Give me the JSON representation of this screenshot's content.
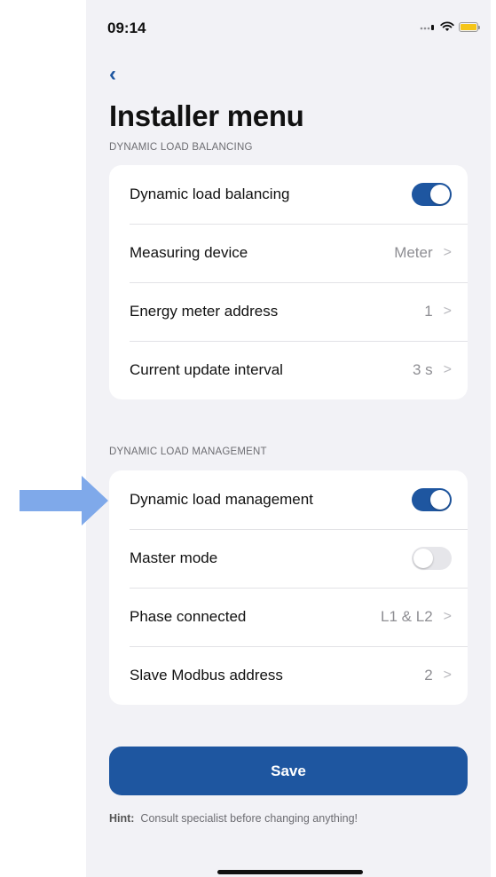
{
  "status_bar": {
    "time": "09:14"
  },
  "nav": {
    "back_glyph": "‹"
  },
  "page": {
    "title": "Installer menu"
  },
  "sections": [
    {
      "header": "DYNAMIC LOAD BALANCING",
      "rows": [
        {
          "label": "Dynamic load balancing",
          "type": "toggle",
          "on": true
        },
        {
          "label": "Measuring device",
          "type": "value",
          "value": "Meter"
        },
        {
          "label": "Energy meter address",
          "type": "value",
          "value": "1"
        },
        {
          "label": "Current update interval",
          "type": "value",
          "value": "3 s"
        }
      ]
    },
    {
      "header": "DYNAMIC LOAD MANAGEMENT",
      "rows": [
        {
          "label": "Dynamic load management",
          "type": "toggle",
          "on": true
        },
        {
          "label": "Master mode",
          "type": "toggle",
          "on": false
        },
        {
          "label": "Phase connected",
          "type": "value",
          "value": "L1 & L2"
        },
        {
          "label": "Slave Modbus address",
          "type": "value",
          "value": "2"
        }
      ]
    }
  ],
  "save_label": "Save",
  "hint": {
    "label": "Hint:",
    "text": "Consult specialist before changing anything!"
  },
  "colors": {
    "accent": "#1e56a0",
    "arrow": "#7fa9ea",
    "background": "#f2f2f6"
  },
  "icons": [
    "signal-icon",
    "wifi-icon",
    "battery-icon",
    "back-chevron-icon",
    "chevron-right-icon",
    "arrow-right-icon"
  ]
}
